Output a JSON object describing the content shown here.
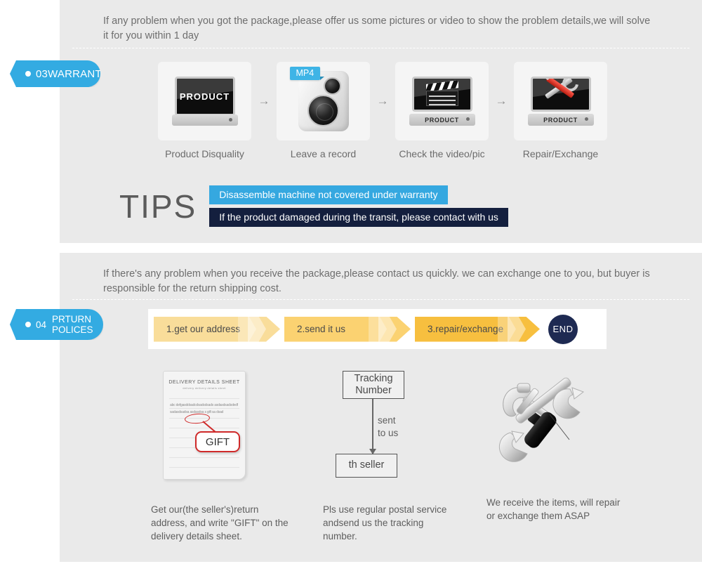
{
  "theme": {
    "panel_bg": "#eaeaea",
    "tab_blue": "#33abe2",
    "tip_blue": "#35a8e0",
    "tip_navy": "#141f3e",
    "end_navy": "#1e2a52",
    "chev_1": "#f9dd9a",
    "chev_2": "#fbd271",
    "chev_3": "#f7bf3f",
    "red_accent": "#cf2a2a"
  },
  "warranty": {
    "tab": {
      "number": "03",
      "label": "WARRANTY"
    },
    "intro": "If any problem when you got the package,please offer us some pictures or video to show the problem details,we will solve it for you within 1 day",
    "steps": [
      {
        "label": "Product Disquality",
        "icon": "monitor-product-icon",
        "screen_text": "PRODUCT"
      },
      {
        "label": "Leave a record",
        "icon": "mp4-recorder-icon",
        "badge": "MP4"
      },
      {
        "label": "Check the video/pic",
        "icon": "monitor-clapper-icon",
        "base_text": "PRODUCT"
      },
      {
        "label": "Repair/Exchange",
        "icon": "monitor-tools-icon",
        "base_text": "PRODUCT"
      }
    ],
    "step_arrow": "→",
    "tips": {
      "heading": "TIPS",
      "lines": [
        "Disassemble machine not covered under warranty",
        "If the product damaged during the transit, please contact with us"
      ]
    }
  },
  "returns": {
    "tab": {
      "number": "04",
      "label_line1": "PRTURN",
      "label_line2": "POLICES"
    },
    "intro": "If  there's any problem when you receive the package,please contact us quickly. we can exchange one to you, but buyer is responsible for the return shipping cost.",
    "ribbon": {
      "steps": [
        "1.get our address",
        "2.send it us",
        "3.repair/exchange"
      ],
      "end_label": "END"
    },
    "columns": [
      {
        "graphic": "delivery-details-sheet",
        "sheet": {
          "title": "DELIVERY DETAILS SHEET",
          "subtitle": "delivery            delivery details sheet",
          "scribble": "abc defgasddsadcdsadsdsads asdasdsadsdedfsadasdsadsa asdasdsa s gift sa dsad",
          "bubble": "GIFT"
        },
        "caption": "Get our(the seller's)return address, and write \"GIFT\" on the delivery details sheet."
      },
      {
        "graphic": "tracking-number-flow",
        "flow": {
          "box_top": "Tracking Number",
          "edge_label": "sent to us",
          "box_bottom": "th seller"
        },
        "caption": "Pls use regular postal service andsend us the tracking number."
      },
      {
        "graphic": "hammer-wrench-screwdriver-icon",
        "caption": "We receive the items, will repair or exchange them ASAP"
      }
    ]
  }
}
